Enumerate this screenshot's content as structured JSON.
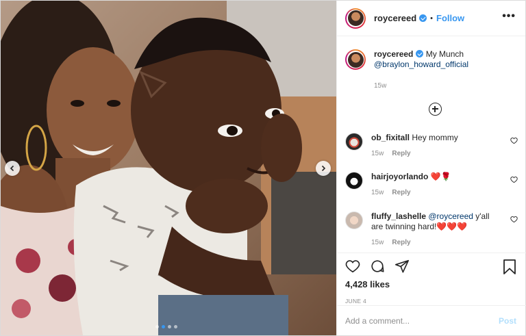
{
  "header": {
    "username": "roycereed",
    "separator": "•",
    "follow_label": "Follow",
    "more_label": "•••"
  },
  "caption": {
    "username": "roycereed",
    "text": "My Munch",
    "mention": "@braylon_howard_official",
    "time": "15w"
  },
  "comments": [
    {
      "username": "ob_fixitall",
      "text": "Hey mommy",
      "time": "15w",
      "reply_label": "Reply"
    },
    {
      "username": "hairjoyorlando",
      "text": "❤️🌹",
      "time": "15w",
      "reply_label": "Reply"
    },
    {
      "username": "fluffy_lashelle",
      "mention": "@roycereed",
      "text": " y'all are twinning hard!❤️❤️❤️",
      "time": "15w",
      "reply_label": "Reply"
    }
  ],
  "actions": {
    "likes": "4,428 likes",
    "date": "JUNE 4"
  },
  "add_comment": {
    "placeholder": "Add a comment...",
    "post_label": "Post"
  },
  "carousel": {
    "slide_count": 4,
    "active_index": 1
  },
  "colors": {
    "accent": "#3897f0",
    "text": "#262626",
    "muted": "#8e8e8e",
    "heart": "#ed4956"
  },
  "icons": [
    "chevron-left-icon",
    "chevron-right-icon",
    "verified-icon",
    "more-icon",
    "add-circle-icon",
    "heart-icon",
    "comment-icon",
    "share-icon",
    "bookmark-icon"
  ]
}
